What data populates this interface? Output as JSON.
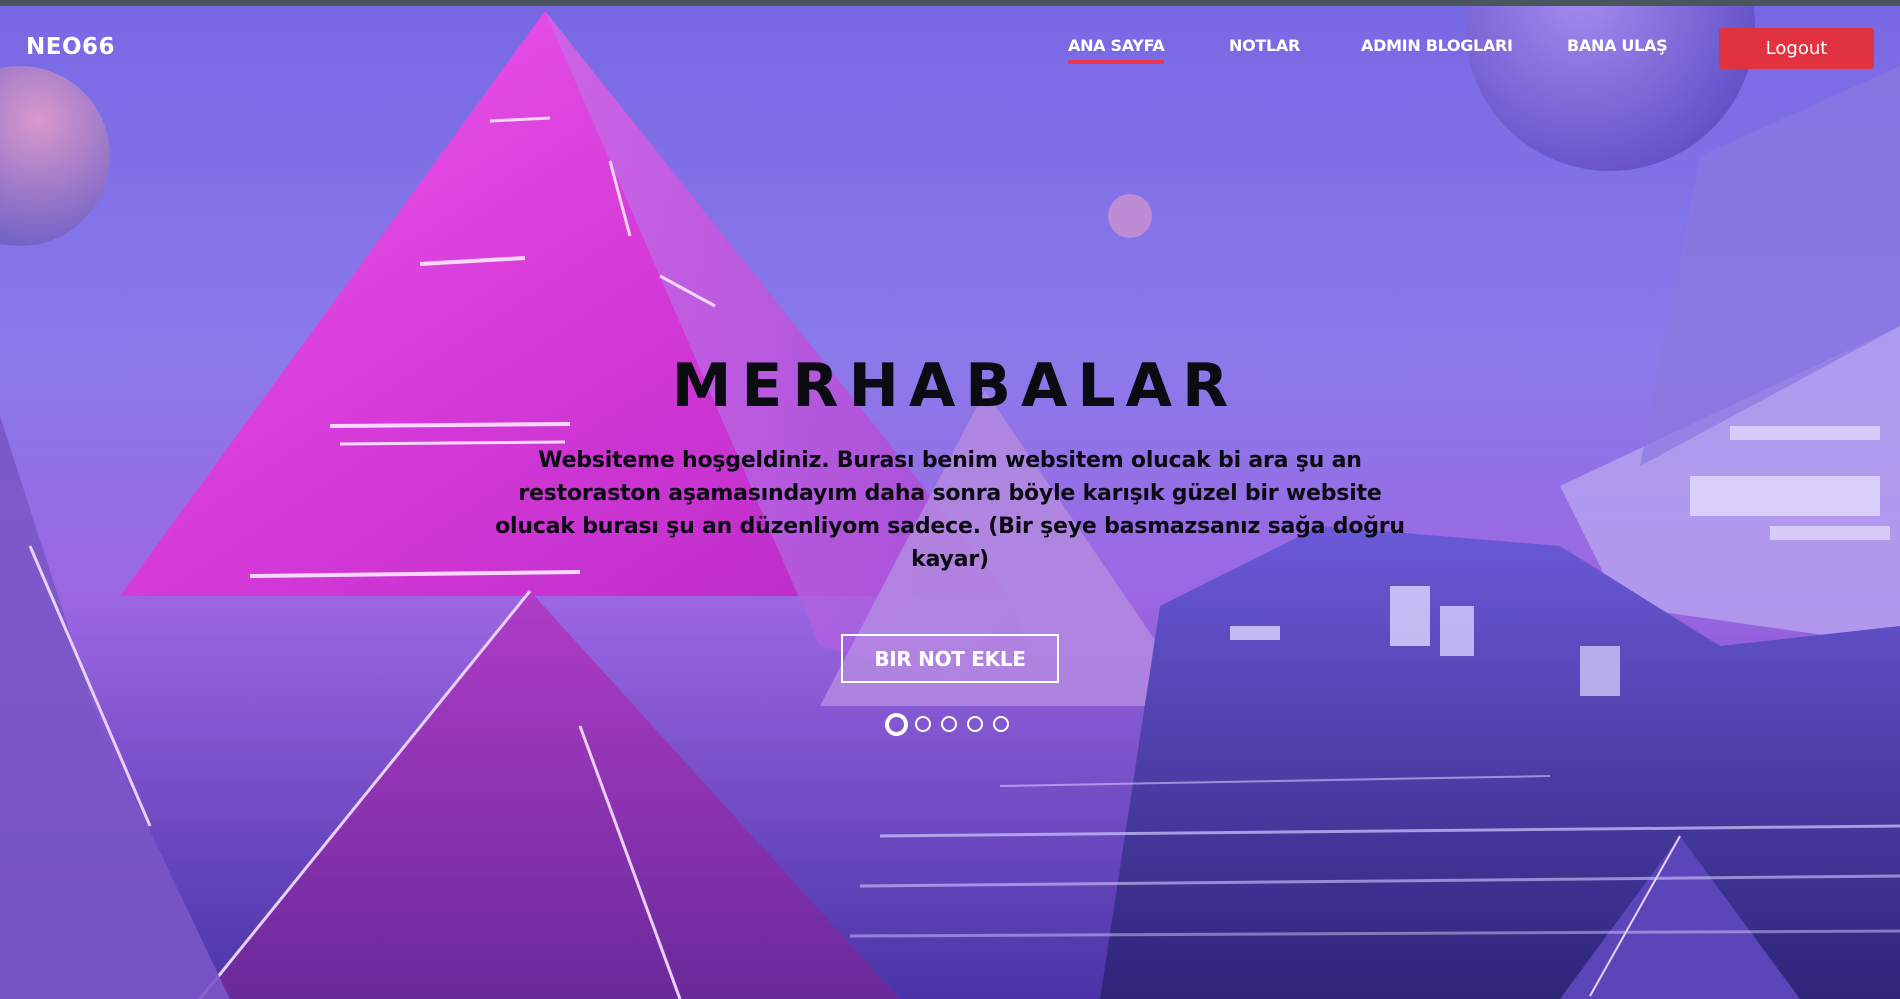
{
  "header": {
    "logo": "NEO66",
    "nav": [
      {
        "label": "ANA SAYFA",
        "active": true
      },
      {
        "label": "NOTLAR",
        "active": false
      },
      {
        "label": "ADMIN BLOGLARI",
        "active": false
      },
      {
        "label": "BANA ULAŞ",
        "active": false
      }
    ],
    "logout_label": "Logout"
  },
  "hero": {
    "title": "MERHABALAR",
    "text": "Websiteme hoşgeldiniz. Burası benim websitem olucak bi ara şu an restoraston aşamasındayım daha sonra böyle karışık güzel bir website olucak burası şu an düzenliyom sadece. (Bir şeye basmazsanız sağa doğru kayar)",
    "cta_label": "BIR NOT EKLE",
    "slides_total": 5,
    "active_slide": 1
  },
  "colors": {
    "accent": "#e0323f",
    "nav_underline": "#e8364a",
    "text_dark": "#0b0b12",
    "text_light": "#ffffff"
  }
}
